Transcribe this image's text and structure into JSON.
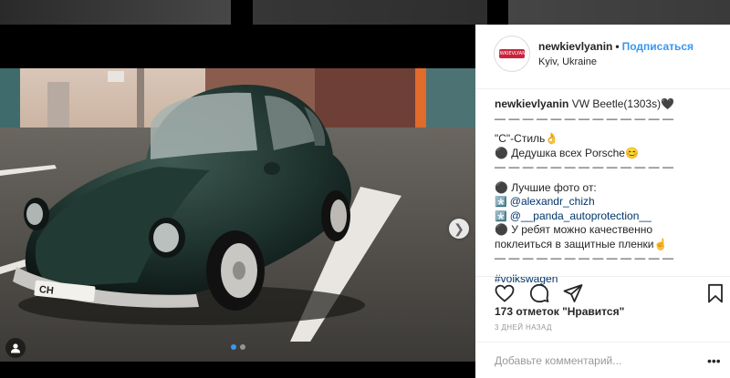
{
  "post": {
    "username": "newkievlyanin",
    "bullet": "•",
    "follow_label": "Подписаться",
    "location": "Kyiv, Ukraine",
    "avatar_text": "NEWKIEVLYANIN",
    "caption_lines": [
      {
        "user": "newkievlyanin",
        "text": " VW Beetle(1303s)🖤"
      },
      {
        "text": "— — — — — — — — — — — — —"
      },
      {
        "text": "\"C\"-Стиль👌"
      },
      {
        "text": "⚫ Дедушка всех Porsche😊"
      },
      {
        "text": "— — — — — — — — — — — — —"
      },
      {
        "text": "⚫ Лучшие фото от:"
      },
      {
        "prefix": "*️⃣ ",
        "link": "@alexandr_chizh"
      },
      {
        "prefix": "*️⃣ ",
        "link": "@__panda_autoprotection__"
      },
      {
        "text": "⚫ У ребят можно качественно"
      },
      {
        "text": "поклеиться в защитные пленки☝"
      },
      {
        "text": "— — — — — — — — — — — — —"
      },
      {
        "link": "#volkswagen"
      }
    ],
    "likes_count": "173 отметок",
    "likes_label": "\"Нравится\"",
    "time_ago": "3 ДНЕЙ НАЗАД",
    "comment_placeholder": "Добавьте комментарий...",
    "more_label": "•••"
  },
  "carousel": {
    "next_icon": "chevron-right-icon",
    "dots_total": 2,
    "dots_active": 0
  },
  "icons": {
    "like": "heart-icon",
    "comment": "comment-icon",
    "share": "share-icon",
    "save": "bookmark-icon",
    "tag": "user-tag-icon"
  },
  "colors": {
    "link": "#003569",
    "accent": "#3897f0",
    "text": "#262626",
    "muted": "#999999",
    "car": "#1f2f2b"
  }
}
